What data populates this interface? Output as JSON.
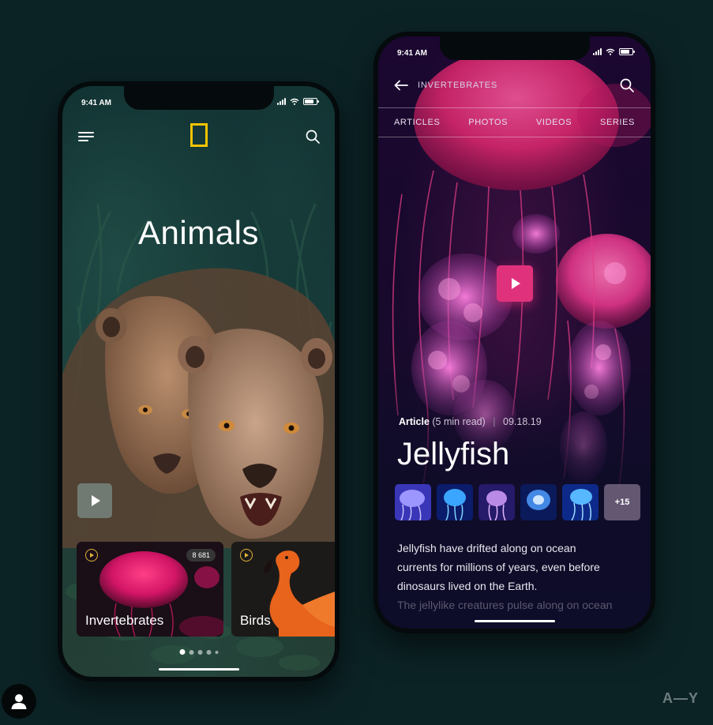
{
  "left_phone": {
    "status_time": "9:41 AM",
    "hero_title": "Animals",
    "cards": [
      {
        "label": "Invertebrates",
        "count": "8 681"
      },
      {
        "label": "Birds"
      }
    ],
    "page_dots": 5,
    "active_dot": 0
  },
  "right_phone": {
    "status_time": "9:41 AM",
    "section_title": "INVERTEBRATES",
    "tabs": [
      "ARTICLES",
      "PHOTOS",
      "VIDEOS",
      "SERIES"
    ],
    "article": {
      "type": "Article",
      "duration": "(5 min read)",
      "separator": "|",
      "date": "09.18.19",
      "title": "Jellyfish",
      "more_photos": "+15",
      "body_lines": [
        "Jellyfish have drifted along on ocean",
        "currents for millions of years, even before",
        "dinosaurs lived on the Earth."
      ],
      "body_faded_line": "The jellylike creatures pulse along on ocean"
    }
  },
  "watermark": "A—Y",
  "colors": {
    "background": "#0c2326",
    "natgeo_yellow": "#f2c300",
    "play_accent": "#e0327c",
    "card_play": "#e2b43a"
  },
  "icons": [
    "menu-icon",
    "natgeo-logo",
    "search-icon",
    "play-icon",
    "back-arrow-icon",
    "signal-icon",
    "wifi-icon",
    "battery-icon",
    "user-icon"
  ]
}
